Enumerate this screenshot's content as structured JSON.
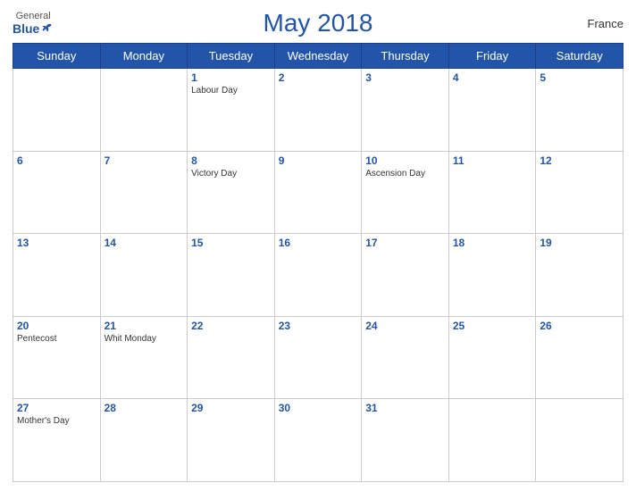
{
  "header": {
    "title": "May 2018",
    "country": "France",
    "logo_general": "General",
    "logo_blue": "Blue"
  },
  "weekdays": [
    "Sunday",
    "Monday",
    "Tuesday",
    "Wednesday",
    "Thursday",
    "Friday",
    "Saturday"
  ],
  "weeks": [
    [
      {
        "day": "",
        "holiday": ""
      },
      {
        "day": "",
        "holiday": ""
      },
      {
        "day": "1",
        "holiday": "Labour Day"
      },
      {
        "day": "2",
        "holiday": ""
      },
      {
        "day": "3",
        "holiday": ""
      },
      {
        "day": "4",
        "holiday": ""
      },
      {
        "day": "5",
        "holiday": ""
      }
    ],
    [
      {
        "day": "6",
        "holiday": ""
      },
      {
        "day": "7",
        "holiday": ""
      },
      {
        "day": "8",
        "holiday": "Victory Day"
      },
      {
        "day": "9",
        "holiday": ""
      },
      {
        "day": "10",
        "holiday": "Ascension Day"
      },
      {
        "day": "11",
        "holiday": ""
      },
      {
        "day": "12",
        "holiday": ""
      }
    ],
    [
      {
        "day": "13",
        "holiday": ""
      },
      {
        "day": "14",
        "holiday": ""
      },
      {
        "day": "15",
        "holiday": ""
      },
      {
        "day": "16",
        "holiday": ""
      },
      {
        "day": "17",
        "holiday": ""
      },
      {
        "day": "18",
        "holiday": ""
      },
      {
        "day": "19",
        "holiday": ""
      }
    ],
    [
      {
        "day": "20",
        "holiday": "Pentecost"
      },
      {
        "day": "21",
        "holiday": "Whit Monday"
      },
      {
        "day": "22",
        "holiday": ""
      },
      {
        "day": "23",
        "holiday": ""
      },
      {
        "day": "24",
        "holiday": ""
      },
      {
        "day": "25",
        "holiday": ""
      },
      {
        "day": "26",
        "holiday": ""
      }
    ],
    [
      {
        "day": "27",
        "holiday": "Mother's Day"
      },
      {
        "day": "28",
        "holiday": ""
      },
      {
        "day": "29",
        "holiday": ""
      },
      {
        "day": "30",
        "holiday": ""
      },
      {
        "day": "31",
        "holiday": ""
      },
      {
        "day": "",
        "holiday": ""
      },
      {
        "day": "",
        "holiday": ""
      }
    ]
  ]
}
